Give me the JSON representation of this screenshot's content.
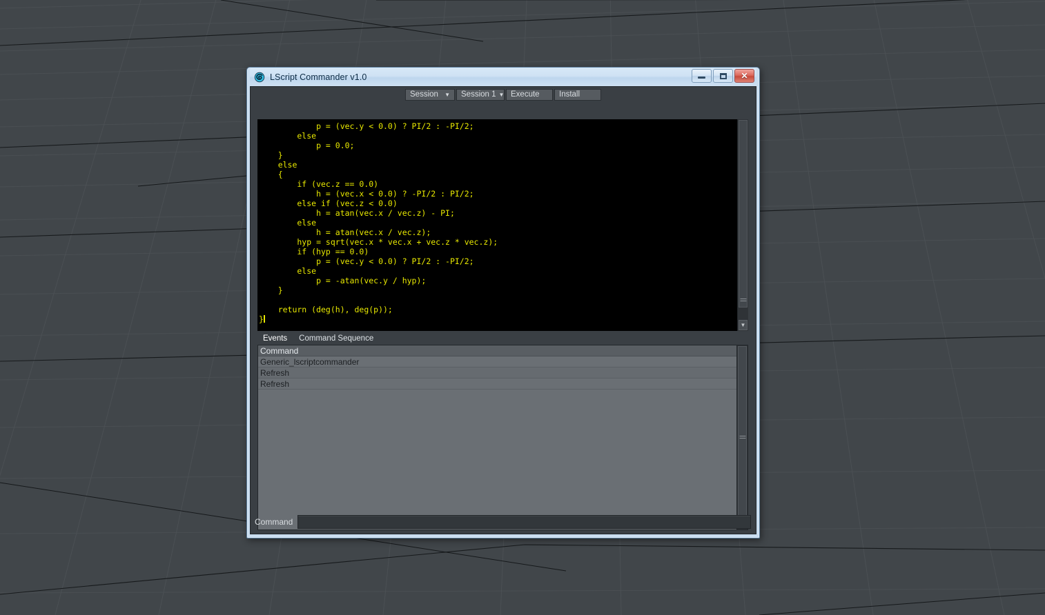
{
  "window": {
    "title": "LScript Commander v1.0",
    "icon": "lightwave-spiral-icon",
    "controls": {
      "minimize": "minimize-icon",
      "maximize": "maximize-icon",
      "close": "✕"
    }
  },
  "toolbar": {
    "session_menu": {
      "label": "Session",
      "caret": "▼"
    },
    "session_select": {
      "label": "Session 1",
      "caret": "▼"
    },
    "execute_label": "Execute",
    "install_label": "Install"
  },
  "editor": {
    "language": "lscript",
    "text_color": "#e8e800",
    "background": "#000000",
    "code": "            p = (vec.y < 0.0) ? PI/2 : -PI/2;\n        else\n            p = 0.0;\n    }\n    else\n    {\n        if (vec.z == 0.0)\n            h = (vec.x < 0.0) ? -PI/2 : PI/2;\n        else if (vec.z < 0.0)\n            h = atan(vec.x / vec.z) - PI;\n        else\n            h = atan(vec.x / vec.z);\n        hyp = sqrt(vec.x * vec.x + vec.z * vec.z);\n        if (hyp == 0.0)\n            p = (vec.y < 0.0) ? PI/2 : -PI/2;\n        else\n            p = -atan(vec.y / hyp);\n    }\n\n    return (deg(h), deg(p));\n}"
  },
  "tabs": [
    {
      "label": "Events",
      "active": true
    },
    {
      "label": "Command Sequence",
      "active": false
    }
  ],
  "list": {
    "columns": [
      "Command"
    ],
    "rows": [
      "Generic_lscriptcommander",
      "Refresh",
      "Refresh"
    ]
  },
  "command_bar": {
    "label": "Command",
    "value": "",
    "placeholder": ""
  },
  "scrollbars": {
    "editor": {
      "arrow_down": "▼",
      "grip": "grip-lines-icon"
    },
    "list": {
      "grip": "grip-lines-icon"
    }
  },
  "colors": {
    "titlebar": "#cfe2f4",
    "window_frame": "#c9ddf0",
    "client_bg": "#3a3f44",
    "list_bg": "#6a6f74",
    "tab_active": "#4f6f92",
    "tab_inactive": "#5b6065",
    "close_button": "#c74a3c",
    "viewport_bg": "#41464a"
  }
}
